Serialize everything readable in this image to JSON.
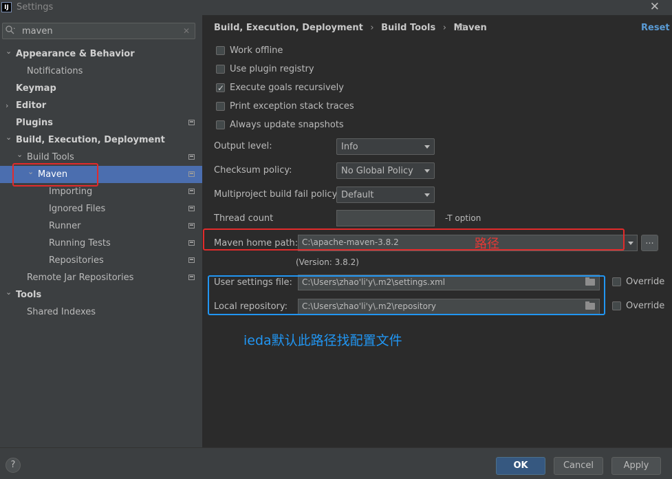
{
  "window": {
    "title": "Settings",
    "app_icon": "IJ"
  },
  "search": {
    "value": "maven"
  },
  "sidebar": {
    "items": [
      {
        "label": "Appearance & Behavior",
        "level": 0,
        "bold": true,
        "expanded": true,
        "chevron": "down"
      },
      {
        "label": "Notifications",
        "level": 1
      },
      {
        "label": "Keymap",
        "level": 0,
        "bold": true
      },
      {
        "label": "Editor",
        "level": 0,
        "bold": true,
        "chevron": "right"
      },
      {
        "label": "Plugins",
        "level": 0,
        "bold": true,
        "proj": true
      },
      {
        "label": "Build, Execution, Deployment",
        "level": 0,
        "bold": true,
        "chevron": "down"
      },
      {
        "label": "Build Tools",
        "level": 1,
        "chevron": "down",
        "proj": true
      },
      {
        "label": "Maven",
        "level": 2,
        "chevron": "down",
        "proj": true,
        "selected": true
      },
      {
        "label": "Importing",
        "level": 3,
        "proj": true
      },
      {
        "label": "Ignored Files",
        "level": 3,
        "proj": true
      },
      {
        "label": "Runner",
        "level": 3,
        "proj": true
      },
      {
        "label": "Running Tests",
        "level": 3,
        "proj": true
      },
      {
        "label": "Repositories",
        "level": 3,
        "proj": true
      },
      {
        "label": "Remote Jar Repositories",
        "level": 1,
        "proj": true
      },
      {
        "label": "Tools",
        "level": 0,
        "bold": true,
        "chevron": "down"
      },
      {
        "label": "Shared Indexes",
        "level": 1
      }
    ]
  },
  "breadcrumb": {
    "part1": "Build, Execution, Deployment",
    "sep": "›",
    "part2": "Build Tools",
    "part3": "Maven"
  },
  "reset_label": "Reset",
  "checkboxes": [
    {
      "label": "Work offline",
      "checked": false
    },
    {
      "label": "Use plugin registry",
      "checked": false
    },
    {
      "label": "Execute goals recursively",
      "checked": true
    },
    {
      "label": "Print exception stack traces",
      "checked": false
    },
    {
      "label": "Always update snapshots",
      "checked": false
    }
  ],
  "fields": {
    "output_level": {
      "label": "Output level:",
      "value": "Info"
    },
    "checksum_policy": {
      "label": "Checksum policy:",
      "value": "No Global Policy"
    },
    "fail_policy": {
      "label": "Multiproject build fail policy:",
      "value": "Default"
    },
    "thread_count": {
      "label": "Thread count",
      "value": "",
      "suffix": "-T option"
    },
    "maven_home": {
      "label": "Maven home path:",
      "value": "C:\\apache-maven-3.8.2",
      "version": "(Version: 3.8.2)",
      "browse": "..."
    },
    "user_settings": {
      "label": "User settings file:",
      "value": "C:\\Users\\zhao'li'y\\.m2\\settings.xml",
      "override": "Override",
      "override_checked": false
    },
    "local_repo": {
      "label": "Local repository:",
      "value": "C:\\Users\\zhao'li'y\\.m2\\repository",
      "override": "Override",
      "override_checked": false
    }
  },
  "annotations": {
    "red_text": "路径",
    "blue_text": "ieda默认此路径找配置文件",
    "red_color": "#e32b2b",
    "blue_color": "#2196f3"
  },
  "footer": {
    "help": "?",
    "ok": "OK",
    "cancel": "Cancel",
    "apply": "Apply"
  }
}
